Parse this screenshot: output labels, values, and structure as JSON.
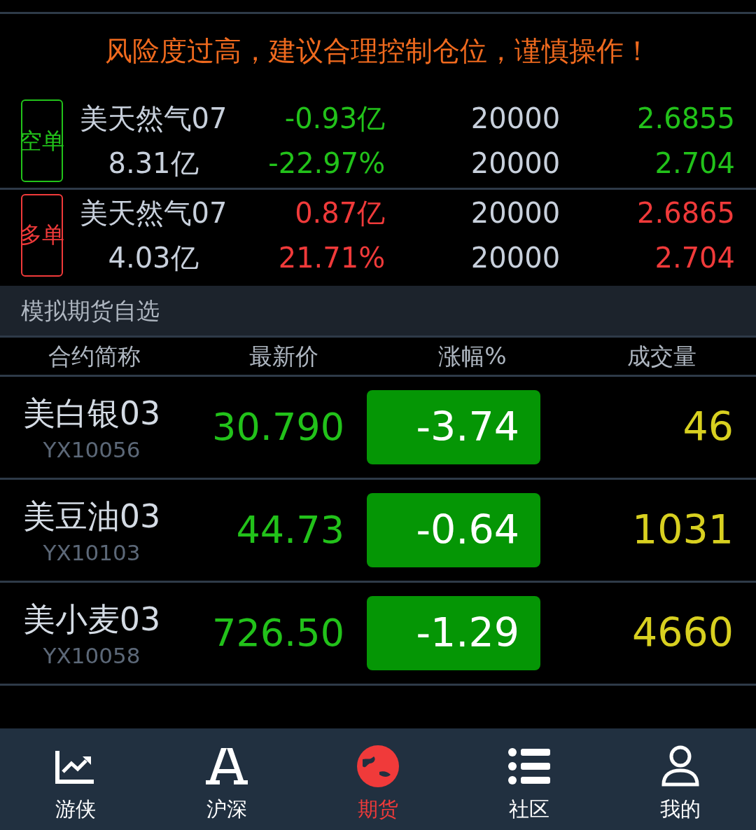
{
  "warning": "风险度过高，建议合理控制仓位，谨慎操作！",
  "positions": [
    {
      "kind": "short",
      "label": "空单",
      "contract": "美天然气07",
      "amount": "8.31亿",
      "pnl": "-0.93亿",
      "pnl_pct": "-22.97%",
      "qty": "20000",
      "qty_available": "20000",
      "price_1": "2.6855",
      "price_2": "2.704"
    },
    {
      "kind": "long",
      "label": "多单",
      "contract": "美天然气07",
      "amount": "4.03亿",
      "pnl": "0.87亿",
      "pnl_pct": "21.71%",
      "qty": "20000",
      "qty_available": "20000",
      "price_1": "2.6865",
      "price_2": "2.704"
    }
  ],
  "watchlist": {
    "title": "模拟期货自选",
    "columns": [
      "合约简称",
      "最新价",
      "涨幅%",
      "成交量"
    ],
    "rows": [
      {
        "name": "美白银03",
        "code": "YX10056",
        "price": "30.790",
        "change": "-3.74",
        "volume": "46"
      },
      {
        "name": "美豆油03",
        "code": "YX10103",
        "price": "44.73",
        "change": "-0.64",
        "volume": "1031"
      },
      {
        "name": "美小麦03",
        "code": "YX10058",
        "price": "726.50",
        "change": "-1.29",
        "volume": "4660"
      }
    ]
  },
  "tab_bar": [
    {
      "label": "游侠",
      "selected": false
    },
    {
      "label": "沪深",
      "selected": false
    },
    {
      "label": "期货",
      "selected": true
    },
    {
      "label": "社区",
      "selected": false
    },
    {
      "label": "我的",
      "selected": false
    }
  ]
}
